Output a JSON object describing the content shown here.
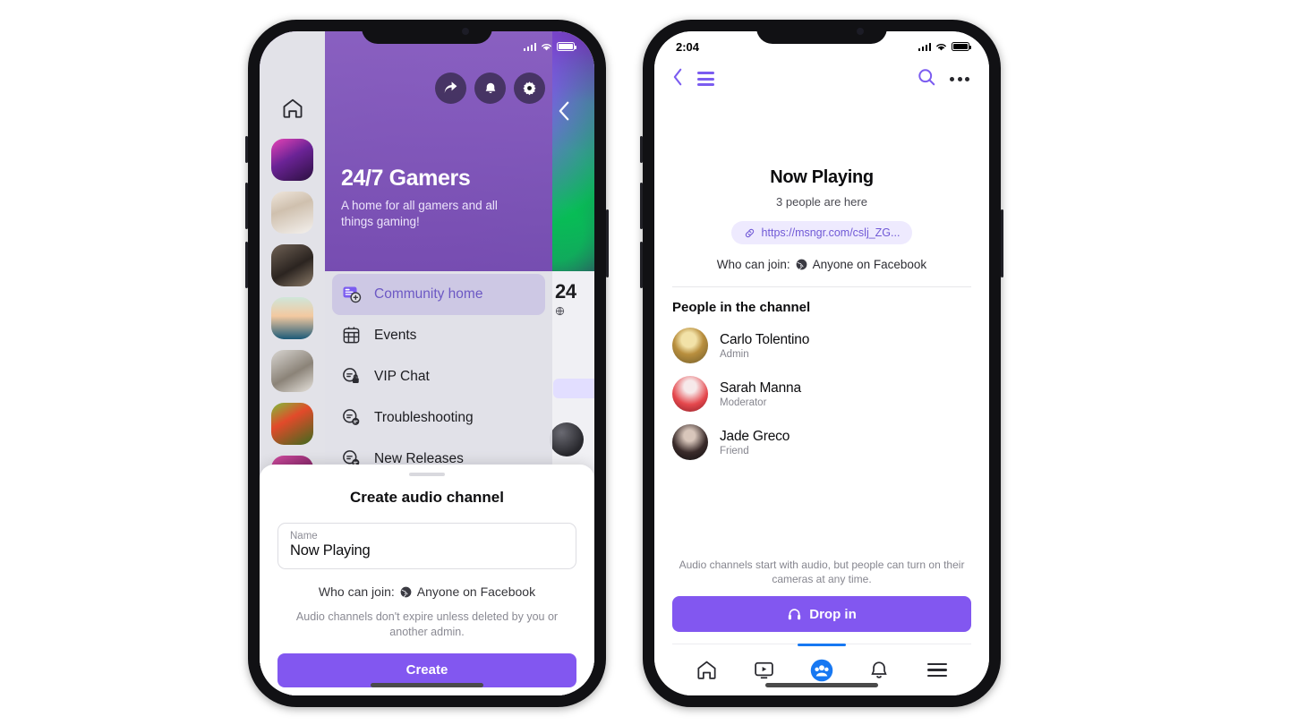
{
  "left_phone": {
    "status_bar": {
      "time": "",
      "signal_icon": "cellular-icon",
      "wifi_icon": "wifi-icon",
      "battery_icon": "battery-icon"
    },
    "back_icon": "back-chevron-icon",
    "rail": {
      "home_icon": "home-icon",
      "items": [
        {
          "name": "community-thumb-1"
        },
        {
          "name": "community-thumb-2"
        },
        {
          "name": "community-thumb-3"
        },
        {
          "name": "community-thumb-4"
        },
        {
          "name": "community-thumb-5"
        },
        {
          "name": "community-thumb-6"
        },
        {
          "name": "community-thumb-7"
        }
      ]
    },
    "community": {
      "title": "24/7 Gamers",
      "description": "A home for all gamers and all things gaming!",
      "actions": [
        {
          "icon": "share-icon"
        },
        {
          "icon": "bell-icon"
        },
        {
          "icon": "gear-icon"
        }
      ]
    },
    "menu": [
      {
        "label": "Community home",
        "icon": "community-home-icon",
        "active": true
      },
      {
        "label": "Events",
        "icon": "calendar-icon",
        "active": false
      },
      {
        "label": "VIP Chat",
        "icon": "locked-chat-icon",
        "active": false
      },
      {
        "label": "Troubleshooting",
        "icon": "chat-icon",
        "active": false
      },
      {
        "label": "New Releases",
        "icon": "chat-icon",
        "active": false
      }
    ],
    "behind": {
      "title": "24"
    },
    "sheet": {
      "title": "Create audio channel",
      "name_label": "Name",
      "name_value": "Now Playing",
      "name_placeholder": "Name",
      "who_can_join_label": "Who can join:",
      "who_can_join_value": "Anyone on Facebook",
      "globe_icon": "globe-icon",
      "note": "Audio channels don't expire unless deleted by you or another admin.",
      "create_label": "Create"
    }
  },
  "right_phone": {
    "status_bar": {
      "time": "2:04",
      "signal_icon": "cellular-icon",
      "wifi_icon": "wifi-icon",
      "battery_icon": "battery-icon"
    },
    "nav": {
      "back_icon": "back-chevron-icon",
      "menu_icon": "hamburger-icon",
      "search_icon": "search-icon",
      "more_icon": "more-dots-icon"
    },
    "channel": {
      "title": "Now Playing",
      "people_count": "3 people are here",
      "link_icon": "link-icon",
      "link": "https://msngr.com/cslj_ZG...",
      "who_can_join_label": "Who can join:",
      "who_can_join_value": "Anyone on Facebook",
      "globe_icon": "globe-icon"
    },
    "people_section": {
      "heading": "People in the channel",
      "people": [
        {
          "name": "Carlo Tolentino",
          "role": "Admin",
          "avatar": "avatar-carlo"
        },
        {
          "name": "Sarah Manna",
          "role": "Moderator",
          "avatar": "avatar-sarah"
        },
        {
          "name": "Jade Greco",
          "role": "Friend",
          "avatar": "avatar-jade"
        }
      ]
    },
    "footer": {
      "note": "Audio channels start with audio, but people can turn on their cameras at any time.",
      "dropin_label": "Drop in",
      "headphones_icon": "headphones-icon"
    },
    "tabbar": [
      {
        "icon": "home-icon",
        "active": false
      },
      {
        "icon": "watch-video-icon",
        "active": false
      },
      {
        "icon": "groups-icon",
        "active": true
      },
      {
        "icon": "bell-icon",
        "active": false
      },
      {
        "icon": "hamburger-menu-icon",
        "active": false
      }
    ]
  },
  "colors": {
    "accent_purple": "#8257f0",
    "link_purple": "#7059d6",
    "chip_bg": "#eeeafe",
    "active_blue": "#1778f2",
    "banner_purple": "#6c3eac"
  }
}
